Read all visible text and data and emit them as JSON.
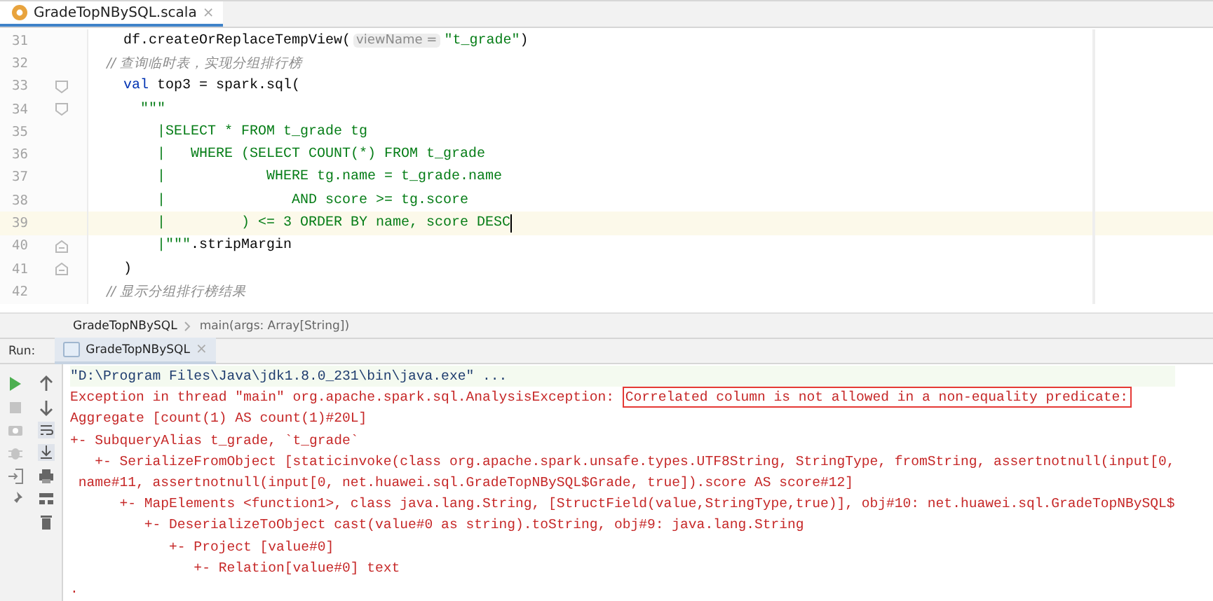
{
  "editor_tabs": [
    {
      "label": "GradeTopNBySQL.scala",
      "selected": true,
      "close": "×"
    }
  ],
  "code_lines": [
    {
      "number": "31",
      "current": false,
      "fold_start": false,
      "fold_end": false,
      "tokens": [
        {
          "kind": "plain",
          "text": "    df.createOrReplaceTempView("
        },
        {
          "kind": "hint",
          "text": "viewName ="
        },
        {
          "kind": "string",
          "text": "\"t_grade\""
        },
        {
          "kind": "plain",
          "text": ")"
        }
      ]
    },
    {
      "number": "32",
      "current": false,
      "fold_start": false,
      "fold_end": false,
      "tokens": [
        {
          "kind": "comment",
          "text": "    // 查询临时表，实现分组排行榜"
        }
      ]
    },
    {
      "number": "33",
      "current": false,
      "fold_start": true,
      "fold_end": false,
      "tokens": [
        {
          "kind": "keyword",
          "text": "    val"
        },
        {
          "kind": "plain",
          "text": " top3 = spark.sql("
        }
      ]
    },
    {
      "number": "34",
      "current": false,
      "fold_start": true,
      "fold_end": false,
      "tokens": [
        {
          "kind": "string",
          "text": "      \"\"\""
        }
      ]
    },
    {
      "number": "35",
      "current": false,
      "fold_start": false,
      "fold_end": false,
      "tokens": [
        {
          "kind": "string",
          "text": "        |SELECT * FROM t_grade tg"
        }
      ]
    },
    {
      "number": "36",
      "current": false,
      "fold_start": false,
      "fold_end": false,
      "tokens": [
        {
          "kind": "string",
          "text": "        |   WHERE (SELECT COUNT(*) FROM t_grade"
        }
      ]
    },
    {
      "number": "37",
      "current": false,
      "fold_start": false,
      "fold_end": false,
      "tokens": [
        {
          "kind": "string",
          "text": "        |            WHERE tg.name = t_grade.name"
        }
      ]
    },
    {
      "number": "38",
      "current": false,
      "fold_start": false,
      "fold_end": false,
      "tokens": [
        {
          "kind": "string",
          "text": "        |               AND score >= tg.score"
        }
      ]
    },
    {
      "number": "39",
      "current": true,
      "fold_start": false,
      "fold_end": false,
      "tokens": [
        {
          "kind": "string",
          "text": "        |         ) <= 3 ORDER BY name, score DESC"
        }
      ]
    },
    {
      "number": "40",
      "current": false,
      "fold_start": false,
      "fold_end": true,
      "tokens": [
        {
          "kind": "string",
          "text": "        |\"\"\""
        },
        {
          "kind": "plain",
          "text": ".stripMargin"
        }
      ]
    },
    {
      "number": "41",
      "current": false,
      "fold_start": false,
      "fold_end": true,
      "tokens": [
        {
          "kind": "plain",
          "text": "    )"
        }
      ]
    },
    {
      "number": "42",
      "current": false,
      "fold_start": false,
      "fold_end": false,
      "tokens": [
        {
          "kind": "comment",
          "text": "    // 显示分组排行榜结果"
        }
      ]
    }
  ],
  "breadcrumbs": [
    "GradeTopNBySQL",
    "main(args: Array[String])"
  ],
  "run_panel": {
    "label": "Run:",
    "tabs": [
      {
        "label": "GradeTopNBySQL",
        "selected": true,
        "close": "×"
      }
    ],
    "console_lines": [
      {
        "kind": "command",
        "parts": [
          {
            "text": "\"D:\\Program Files\\Java\\jdk1.8.0_231\\bin\\java.exe\" ..."
          }
        ]
      },
      {
        "kind": "error",
        "parts": [
          {
            "text": "Exception in thread \"main\" org.apache.spark.sql.AnalysisException: ",
            "boxed": false
          },
          {
            "text": "Correlated column is not allowed in a non-equality predicate:",
            "boxed": true
          }
        ]
      },
      {
        "kind": "error",
        "parts": [
          {
            "text": "Aggregate [count(1) AS count(1)#20L]"
          }
        ]
      },
      {
        "kind": "error",
        "parts": [
          {
            "text": "+- SubqueryAlias t_grade, `t_grade`"
          }
        ]
      },
      {
        "kind": "error",
        "parts": [
          {
            "text": "   +- SerializeFromObject [staticinvoke(class org.apache.spark.unsafe.types.UTF8String, StringType, fromString, assertnotnull(input[0,"
          }
        ]
      },
      {
        "kind": "error",
        "parts": [
          {
            "text": " name#11, assertnotnull(input[0, net.huawei.sql.GradeTopNBySQL$Grade, true]).score AS score#12]"
          }
        ]
      },
      {
        "kind": "error",
        "parts": [
          {
            "text": "      +- MapElements <function1>, class java.lang.String, [StructField(value,StringType,true)], obj#10: net.huawei.sql.GradeTopNBySQL$"
          }
        ]
      },
      {
        "kind": "error",
        "parts": [
          {
            "text": "         +- DeserializeToObject cast(value#0 as string).toString, obj#9: java.lang.String"
          }
        ]
      },
      {
        "kind": "error",
        "parts": [
          {
            "text": "            +- Project [value#0]"
          }
        ]
      },
      {
        "kind": "error",
        "parts": [
          {
            "text": "               +- Relation[value#0] text"
          }
        ]
      },
      {
        "kind": "error",
        "parts": [
          {
            "text": "."
          }
        ]
      }
    ]
  }
}
